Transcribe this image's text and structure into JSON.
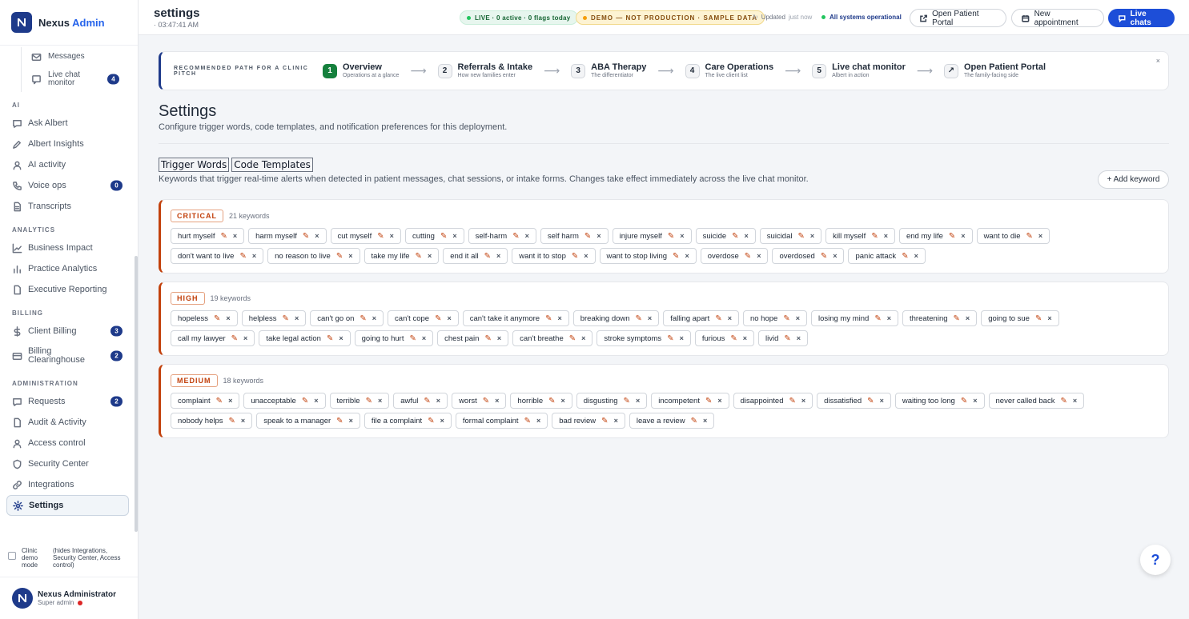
{
  "brand": {
    "name": "Nexus",
    "accent": "Admin"
  },
  "sidebar": {
    "sub_items": [
      {
        "label": "Messages",
        "icon": "mail-icon",
        "badge": ""
      },
      {
        "label": "Live chat monitor",
        "icon": "chat-icon",
        "badge": "4"
      }
    ],
    "sections": [
      {
        "title": "AI",
        "items": [
          {
            "label": "Ask Albert",
            "icon": "chat-icon",
            "badge": ""
          },
          {
            "label": "Albert Insights",
            "icon": "pen-icon",
            "badge": ""
          },
          {
            "label": "AI activity",
            "icon": "user-icon",
            "badge": ""
          },
          {
            "label": "Voice ops",
            "icon": "phone-icon",
            "badge": "0"
          },
          {
            "label": "Transcripts",
            "icon": "document-icon",
            "badge": ""
          }
        ]
      },
      {
        "title": "ANALYTICS",
        "items": [
          {
            "label": "Business Impact",
            "icon": "trend-icon",
            "badge": ""
          },
          {
            "label": "Practice Analytics",
            "icon": "bar-chart-icon",
            "badge": ""
          },
          {
            "label": "Executive Reporting",
            "icon": "document-icon",
            "badge": ""
          }
        ]
      },
      {
        "title": "BILLING",
        "items": [
          {
            "label": "Client Billing",
            "icon": "dollar-icon",
            "badge": "3"
          },
          {
            "label": "Billing Clearinghouse",
            "icon": "card-icon",
            "badge": "2"
          }
        ]
      },
      {
        "title": "ADMINISTRATION",
        "items": [
          {
            "label": "Requests",
            "icon": "chat-icon",
            "badge": "2"
          },
          {
            "label": "Audit & Activity",
            "icon": "document-icon",
            "badge": ""
          },
          {
            "label": "Access control",
            "icon": "user-icon",
            "badge": ""
          },
          {
            "label": "Security Center",
            "icon": "shield-icon",
            "badge": ""
          },
          {
            "label": "Integrations",
            "icon": "link-icon",
            "badge": ""
          },
          {
            "label": "Settings",
            "icon": "gear-icon",
            "badge": ""
          }
        ]
      }
    ],
    "demo_mode": {
      "label": "Clinic demo mode",
      "note": "(hides Integrations, Security Center, Access control)"
    },
    "user": {
      "name": "Nexus Administrator",
      "role": "Super admin"
    }
  },
  "topbar": {
    "title": "settings",
    "time": "· 03:47:41 AM",
    "live_pill": "LIVE · 0 active · 0 flags today",
    "demo_pill": "DEMO — NOT PRODUCTION · SAMPLE DATA",
    "updated_label": "Updated",
    "updated_time": "just now",
    "status": "All systems operational",
    "open_portal": "Open Patient Portal",
    "new_appointment": "New appointment",
    "live_chats": "Live chats"
  },
  "path": {
    "label": "RECOMMENDED PATH FOR A CLINIC PITCH",
    "steps": [
      {
        "num": "1",
        "title": "Overview",
        "sub": "Operations at a glance"
      },
      {
        "num": "2",
        "title": "Referrals & Intake",
        "sub": "How new families enter"
      },
      {
        "num": "3",
        "title": "ABA Therapy",
        "sub": "The differentiator"
      },
      {
        "num": "4",
        "title": "Care Operations",
        "sub": "The live client list"
      },
      {
        "num": "5",
        "title": "Live chat monitor",
        "sub": "Albert in action"
      },
      {
        "num": "↗",
        "title": "Open Patient Portal",
        "sub": "The family-facing side"
      }
    ],
    "close": "×"
  },
  "page": {
    "title": "Settings",
    "subtitle": "Configure trigger words, code templates, and notification preferences for this deployment.",
    "tabs": [
      "Trigger Words",
      "Code Templates"
    ],
    "description": "Keywords that trigger real-time alerts when detected in patient messages, chat sessions, or intake forms. Changes take effect immediately across the live chat monitor.",
    "add_keyword": "+ Add keyword"
  },
  "groups": [
    {
      "level": "CRITICAL",
      "count": "21 keywords",
      "rows": [
        [
          "hurt myself",
          "harm myself",
          "cut myself",
          "cutting",
          "self-harm",
          "self harm",
          "injure myself",
          "suicide",
          "suicidal",
          "kill myself",
          "end my life",
          "want to die"
        ],
        [
          "don't want to live",
          "no reason to live",
          "take my life",
          "end it all",
          "want it to stop",
          "want to stop living",
          "overdose",
          "overdosed",
          "panic attack"
        ]
      ]
    },
    {
      "level": "HIGH",
      "count": "19 keywords",
      "rows": [
        [
          "hopeless",
          "helpless",
          "can't go on",
          "can't cope",
          "can't take it anymore",
          "breaking down",
          "falling apart",
          "no hope",
          "losing my mind",
          "threatening",
          "going to sue"
        ],
        [
          "call my lawyer",
          "take legal action",
          "going to hurt",
          "chest pain",
          "can't breathe",
          "stroke symptoms",
          "furious",
          "livid"
        ]
      ]
    },
    {
      "level": "MEDIUM",
      "count": "18 keywords",
      "rows": [
        [
          "complaint",
          "unacceptable",
          "terrible",
          "awful",
          "worst",
          "horrible",
          "disgusting",
          "incompetent",
          "disappointed",
          "dissatisfied",
          "waiting too long",
          "never called back"
        ],
        [
          "nobody helps",
          "speak to a manager",
          "file a complaint",
          "formal complaint",
          "bad review",
          "leave a review"
        ]
      ]
    }
  ],
  "colors": {
    "accent": "#1e3a8a",
    "primary_button": "#1d4ed8",
    "severity": "#c2410c",
    "live": "#22c55e",
    "demo": "#f59e0b"
  },
  "help": "?"
}
